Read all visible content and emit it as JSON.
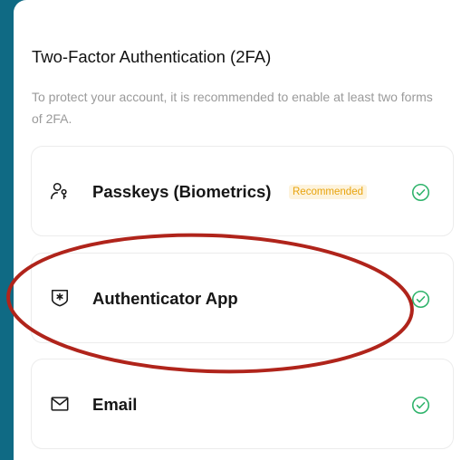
{
  "header": {
    "title": "Two-Factor Authentication (2FA)",
    "description": "To protect your account, it is recommended to enable at least two forms of 2FA."
  },
  "methods": [
    {
      "label": "Passkeys (Biometrics)",
      "badge": "Recommended",
      "icon": "user-key-icon",
      "enabled": true
    },
    {
      "label": "Authenticator App",
      "icon": "shield-asterisk-icon",
      "enabled": true
    },
    {
      "label": "Email",
      "icon": "envelope-icon",
      "enabled": true
    }
  ],
  "colors": {
    "background": "#0f6a84",
    "check": "#2fb36b",
    "badge_text": "#e8a30d",
    "badge_bg": "#fdf3dc",
    "annotation": "#b0241b"
  }
}
